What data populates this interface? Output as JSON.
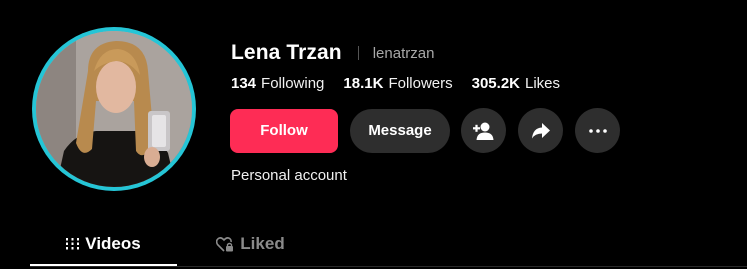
{
  "profile": {
    "display_name": "Lena Trzan",
    "username": "lenatrzan",
    "account_type": "Personal account",
    "ring_color": "#25c5d6"
  },
  "stats": [
    {
      "value": "134",
      "label": "Following"
    },
    {
      "value": "18.1K",
      "label": "Followers"
    },
    {
      "value": "305.2K",
      "label": "Likes"
    }
  ],
  "actions": {
    "follow_label": "Follow",
    "message_label": "Message",
    "follow_color": "#fe2c55",
    "icons": [
      "add-friend-icon",
      "share-icon",
      "more-icon"
    ]
  },
  "tabs": [
    {
      "label": "Videos",
      "icon": "grid-icon",
      "active": true
    },
    {
      "label": "Liked",
      "icon": "heart-lock-icon",
      "active": false
    }
  ]
}
